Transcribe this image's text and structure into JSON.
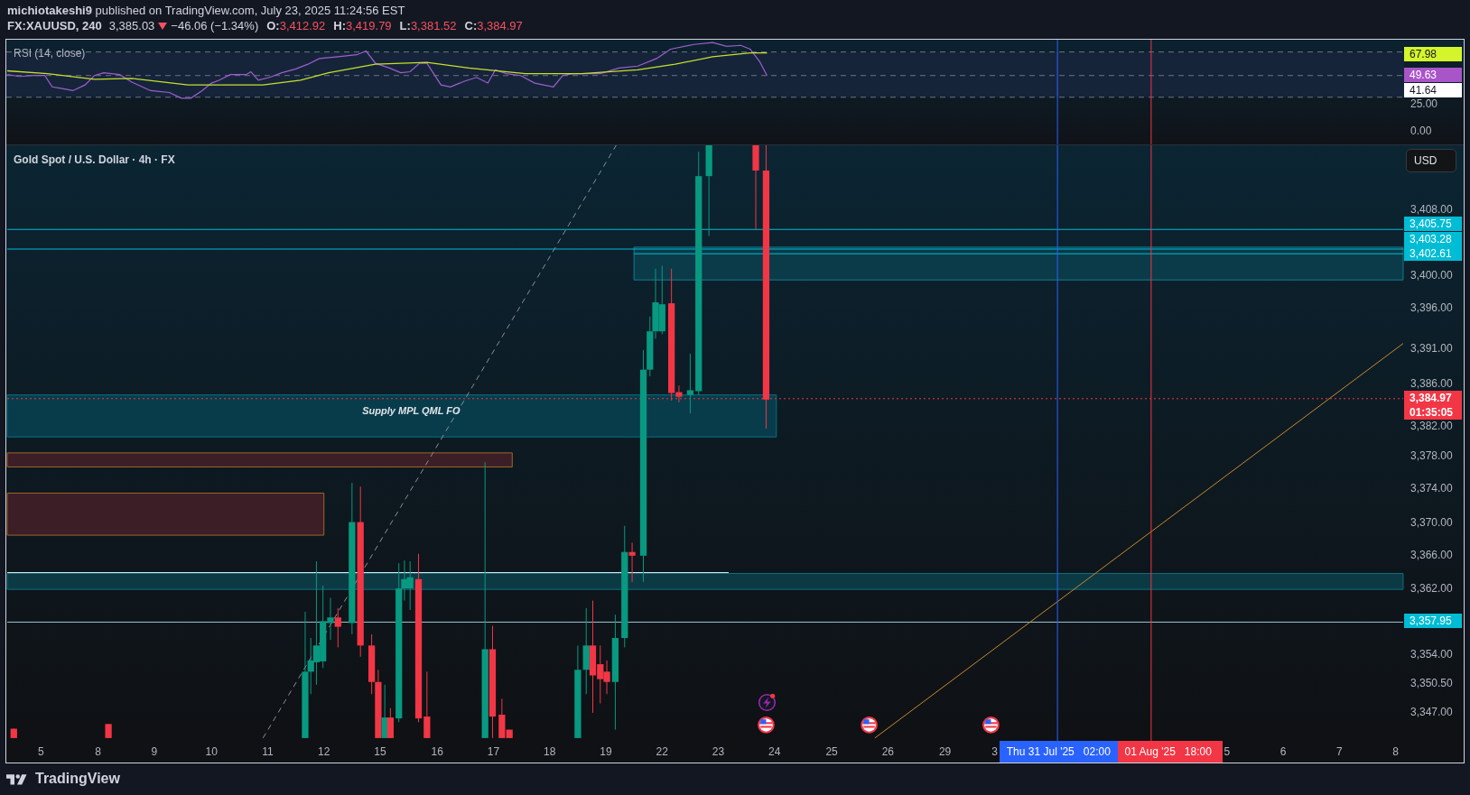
{
  "header": {
    "byline": "**michiotakeshi9** published on TradingView.com, July 23, 2025 11:24:56 EST",
    "symbol": "FX:XAUUSD, 240",
    "last": "3,385.03",
    "falling": true,
    "change": "−46.06 (−1.34%)",
    "ohlc": [
      {
        "label": "O:",
        "value": "3,412.92"
      },
      {
        "label": "H:",
        "value": "3,419.79"
      },
      {
        "label": "L:",
        "value": "3,381.52"
      },
      {
        "label": "C:",
        "value": "3,384.97"
      }
    ]
  },
  "rsi_pane": {
    "legend": "RSI (14, close)",
    "axis": [
      {
        "kind": "tag",
        "text": "67.98",
        "color": "#d4f52b"
      },
      {
        "kind": "tag",
        "text": "49.63",
        "color": "#a855c9"
      },
      {
        "kind": "tag",
        "text": "41.64",
        "color": "#ffffff"
      },
      {
        "kind": "tick",
        "text": "25.00"
      },
      {
        "kind": "tick",
        "text": "0.00"
      }
    ]
  },
  "main_pane": {
    "legend": "Gold Spot / U.S. Dollar · 4h · FX",
    "currency_button": "USD",
    "zone_label": "Supply MPL QML FO",
    "axis": [
      {
        "kind": "tick",
        "text": "3,408.00"
      },
      {
        "kind": "tag",
        "text": "3,405.75",
        "color": "#00bcd4"
      },
      {
        "kind": "tag",
        "text": "3,403.28",
        "color": "#00bcd4"
      },
      {
        "kind": "tag",
        "text": "3,402.61",
        "color": "#00bcd4"
      },
      {
        "kind": "tick",
        "text": "3,400.00"
      },
      {
        "kind": "tick",
        "text": "3,396.00"
      },
      {
        "kind": "tick",
        "text": "3,391.00"
      },
      {
        "kind": "tick",
        "text": "3,386.00"
      },
      {
        "kind": "tag",
        "text": "3,384.97",
        "countdown": "01:35:05",
        "color": "#f23645"
      },
      {
        "kind": "tick",
        "text": "3,382.00"
      },
      {
        "kind": "tick",
        "text": "3,378.00"
      },
      {
        "kind": "tick",
        "text": "3,374.00"
      },
      {
        "kind": "tick",
        "text": "3,370.00"
      },
      {
        "kind": "tick",
        "text": "3,366.00"
      },
      {
        "kind": "tick",
        "text": "3,362.00"
      },
      {
        "kind": "tag",
        "text": "3,357.95",
        "color": "#00bcd4"
      },
      {
        "kind": "tick",
        "text": "3,354.00"
      },
      {
        "kind": "tick",
        "text": "3,350.50"
      },
      {
        "kind": "tick",
        "text": "3,347.00"
      }
    ]
  },
  "time_axis": [
    {
      "kind": "tick",
      "text": "5"
    },
    {
      "kind": "tick",
      "text": "8"
    },
    {
      "kind": "tick",
      "text": "9"
    },
    {
      "kind": "tick",
      "text": "10"
    },
    {
      "kind": "tick",
      "text": "11"
    },
    {
      "kind": "tick",
      "text": "12"
    },
    {
      "kind": "tick",
      "text": "15"
    },
    {
      "kind": "tick",
      "text": "16"
    },
    {
      "kind": "tick",
      "text": "17"
    },
    {
      "kind": "tick",
      "text": "18"
    },
    {
      "kind": "tick",
      "text": "19"
    },
    {
      "kind": "tick",
      "text": "22"
    },
    {
      "kind": "tick",
      "text": "23"
    },
    {
      "kind": "tick",
      "text": "24"
    },
    {
      "kind": "tick",
      "text": "25"
    },
    {
      "kind": "tick",
      "text": "26"
    },
    {
      "kind": "tick",
      "text": "29"
    },
    {
      "kind": "tick",
      "text": "3"
    },
    {
      "kind": "tag",
      "date": "Thu 31 Jul '25",
      "time": "02:00",
      "color": "#2962ff"
    },
    {
      "kind": "tag",
      "date": "01 Aug '25",
      "time": "18:00",
      "color": "#f23645"
    },
    {
      "kind": "tick",
      "text": "5"
    },
    {
      "kind": "tick",
      "text": "6"
    },
    {
      "kind": "tick",
      "text": "7"
    },
    {
      "kind": "tick",
      "text": "8"
    }
  ],
  "footer": {
    "logo": "TradingView"
  }
}
